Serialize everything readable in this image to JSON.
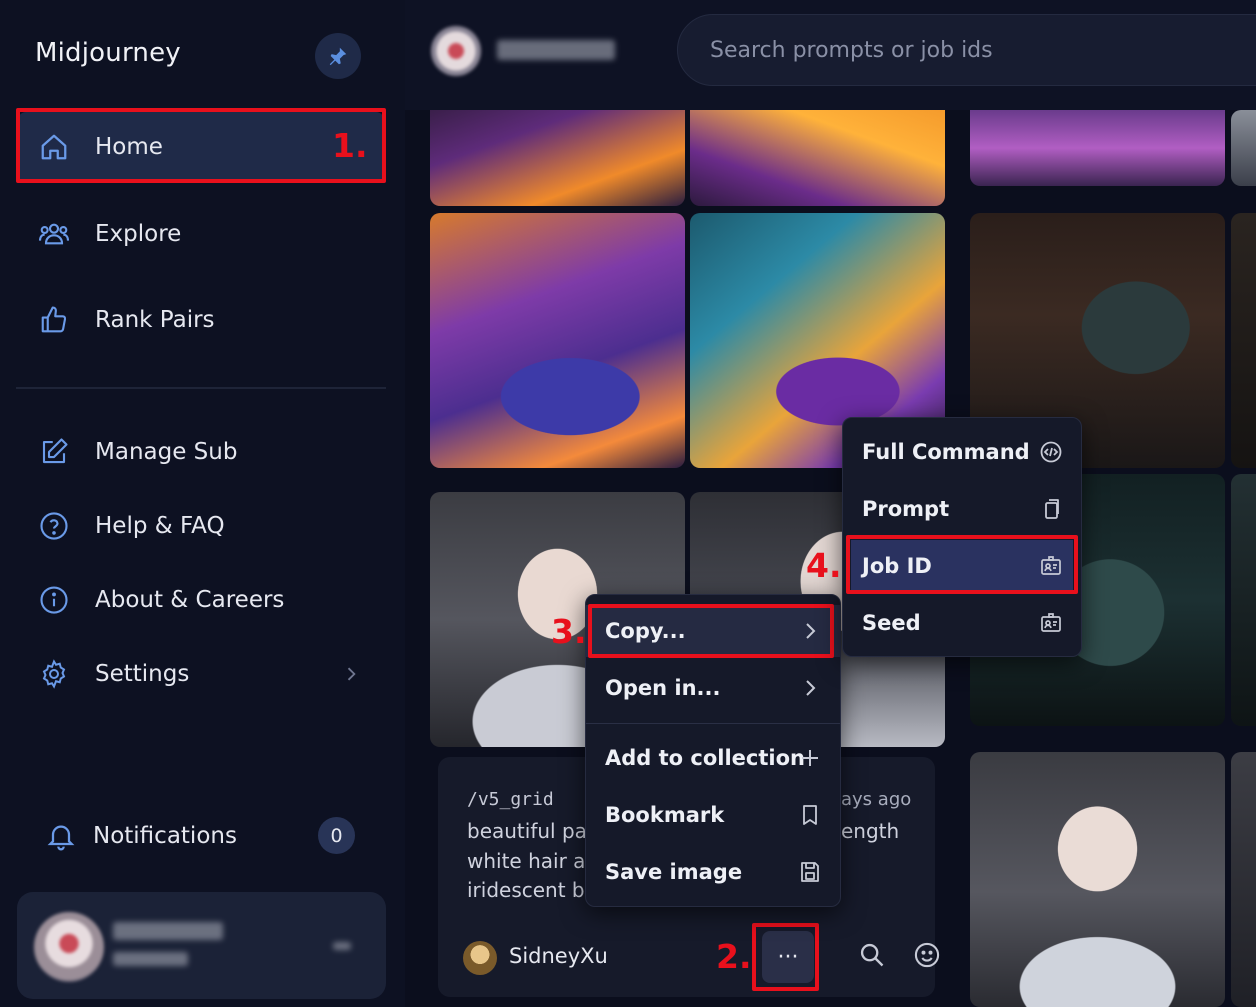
{
  "sidebar": {
    "brand": "Midjourney",
    "items": [
      {
        "label": "Home",
        "icon": "home-icon"
      },
      {
        "label": "Explore",
        "icon": "community-icon"
      },
      {
        "label": "Rank Pairs",
        "icon": "thumbs-up-icon"
      },
      {
        "label": "Manage Sub",
        "icon": "edit-icon"
      },
      {
        "label": "Help & FAQ",
        "icon": "help-icon"
      },
      {
        "label": "About & Careers",
        "icon": "info-icon"
      },
      {
        "label": "Settings",
        "icon": "gear-icon"
      }
    ],
    "notifications": {
      "label": "Notifications",
      "count": "0"
    }
  },
  "header": {
    "search_placeholder": "Search prompts or job ids"
  },
  "hover_card": {
    "command": "/v5_grid",
    "time_ago": "ays ago",
    "prompt_left": [
      "beautiful pa",
      "white hair ar",
      "iridescent b"
    ],
    "prompt_right": [
      "ength"
    ],
    "username": "SidneyXu",
    "more_label": "···"
  },
  "context_menu": {
    "items": [
      {
        "label": "Copy...",
        "icon": "chevron-right-icon"
      },
      {
        "label": "Open in...",
        "icon": "chevron-right-icon"
      },
      {
        "label": "Add to collection",
        "icon": "plus-icon"
      },
      {
        "label": "Bookmark",
        "icon": "bookmark-icon"
      },
      {
        "label": "Save image",
        "icon": "save-icon"
      }
    ]
  },
  "copy_submenu": {
    "items": [
      {
        "label": "Full Command",
        "icon": "code-icon"
      },
      {
        "label": "Prompt",
        "icon": "copy-icon"
      },
      {
        "label": "Job ID",
        "icon": "id-card-icon"
      },
      {
        "label": "Seed",
        "icon": "id-card-icon"
      }
    ]
  },
  "annotations": [
    "1.",
    "2.",
    "3.",
    "4."
  ],
  "colors": {
    "annotation": "#e8101c",
    "accent": "#1f2a48",
    "highlight": "#2a3260"
  }
}
